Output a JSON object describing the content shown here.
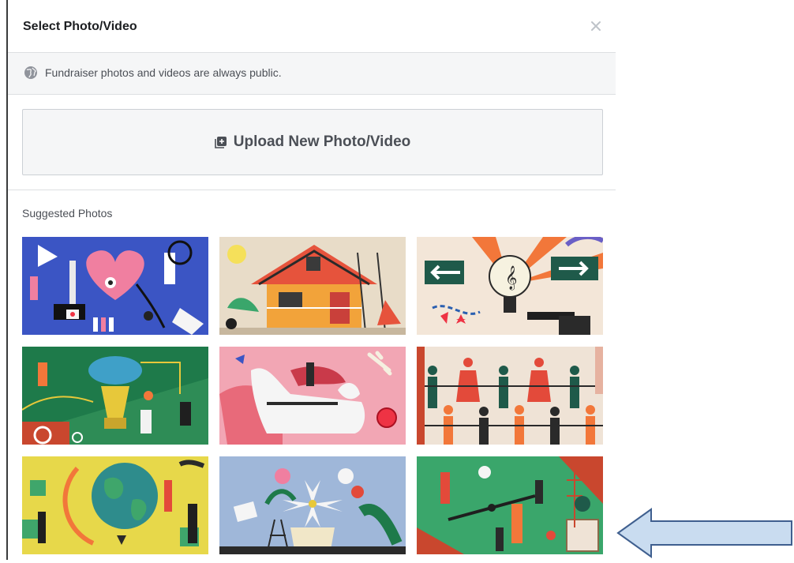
{
  "dialog": {
    "title": "Select Photo/Video",
    "close_icon": "close-icon",
    "notice": {
      "icon": "globe-icon",
      "text": "Fundraiser photos and videos are always public."
    },
    "upload": {
      "icon": "add-photo-icon",
      "label": "Upload New Photo/Video"
    },
    "suggested_label": "Suggested Photos",
    "photos": [
      {
        "theme": "medical research",
        "bg": "#3b55c4"
      },
      {
        "theme": "house building",
        "bg": "#e8dcc8"
      },
      {
        "theme": "music and arts",
        "bg": "#f3e6d8"
      },
      {
        "theme": "sports",
        "bg": "#1e7a4a"
      },
      {
        "theme": "animals",
        "bg": "#f2a6b4"
      },
      {
        "theme": "community",
        "bg": "#efe3d6"
      },
      {
        "theme": "environment",
        "bg": "#e7d84a"
      },
      {
        "theme": "flowers",
        "bg": "#9fb7d9"
      },
      {
        "theme": "park and playground",
        "bg": "#3aa66b"
      }
    ]
  },
  "colors": {
    "accent_arrow_fill": "#c9dcf0",
    "accent_arrow_stroke": "#3f5f8f"
  }
}
